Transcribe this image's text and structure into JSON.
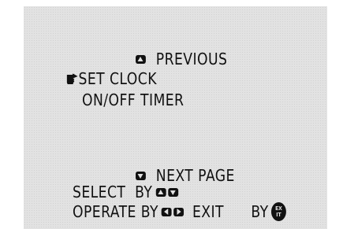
{
  "menu": {
    "previous_label": "PREVIOUS",
    "items": [
      {
        "label": "SET CLOCK",
        "selected": true
      },
      {
        "label": "ON/OFF TIMER",
        "selected": false
      }
    ],
    "next_page_label": "NEXT PAGE"
  },
  "help": {
    "select_label": "SELECT  BY",
    "operate_label": "OPERATE BY",
    "exit_label": "EXIT",
    "exit_by_label": "BY",
    "exit_badge_text": "EXIT"
  },
  "icons": {
    "previous": "up-arrow-icon",
    "next": "down-arrow-icon",
    "select": [
      "up-arrow-icon",
      "down-arrow-icon"
    ],
    "operate": [
      "left-arrow-icon",
      "right-arrow-icon"
    ],
    "pointer": "pointing-hand-icon",
    "exit": "exit-button-icon"
  },
  "colors": {
    "screen_background": "#e2e2e2",
    "text": "#111111"
  }
}
